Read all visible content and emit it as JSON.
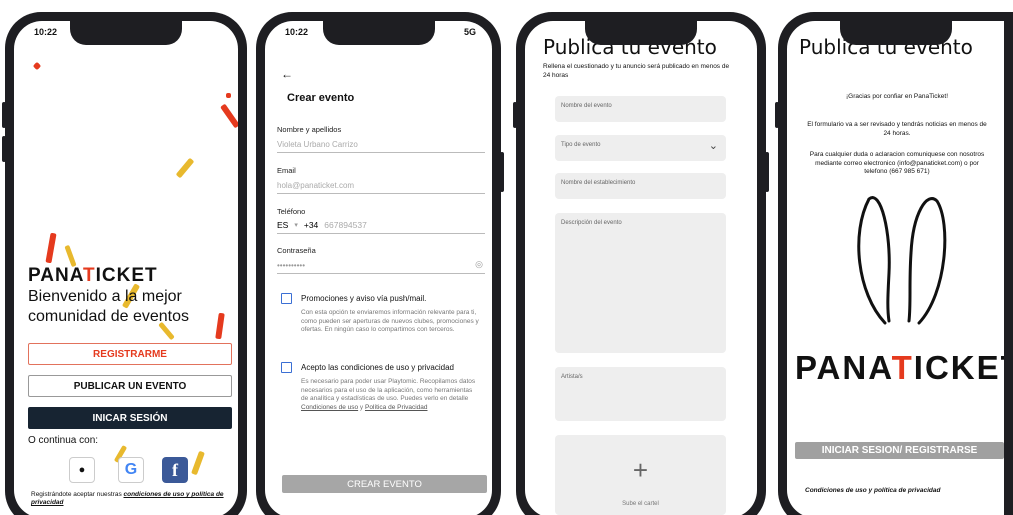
{
  "screen1": {
    "time": "10:22",
    "logo_pre": "PANA",
    "logo_t": "T",
    "logo_post": "ICKET",
    "welcome": "Bienvenido a la mejor comunidad de eventos",
    "register_label": "REGISTRARME",
    "publish_label": "PUBLICAR UN EVENTO",
    "login_label": "INICAR SESIÓN",
    "continue_label": "O continua con:",
    "terms_prefix": "Registrándote aceptar nuestras ",
    "terms_link": "condiciones de uso y política de privacidad",
    "social_icons": [
      "apple-icon",
      "google-icon",
      "facebook-icon"
    ],
    "accent_color": "#e53a1e",
    "dark_color": "#172432"
  },
  "screen2": {
    "time": "10:22",
    "network": "5G",
    "title": "Crear evento",
    "name_label": "Nombre y apellidos",
    "name_value": "Violeta Urbano Carrizo",
    "email_label": "Email",
    "email_value": "hola@panaticket.com",
    "phone_label": "Teléfono",
    "phone_country": "ES",
    "phone_prefix": "+34",
    "phone_value": "667894537",
    "password_label": "Contraseña",
    "password_value": "••••••••••",
    "promo_title": "Promociones y aviso vía push/mail.",
    "promo_desc": "Con esta opción te enviaremos información relevante para ti, como pueden ser aperturas de nuevos clubes, promociones y ofertas. En ningún caso lo compartimos con terceros.",
    "terms_title": "Acepto las condiciones de uso y privacidad",
    "terms_desc": "Es necesario para poder usar Playtomic. Recopilamos datos necesarios para el uso de la aplicación, como herramientas de analítica y estadísticas de uso. Puedes verlo en detalle",
    "terms_link1": "Condiciones de uso",
    "terms_and": " y ",
    "terms_link2": "Política de Privacidad",
    "submit_label": "CREAR EVENTO"
  },
  "screen3": {
    "title": "Publica tu evento",
    "subtitle": "Rellena el cuestionado y tu anuncio será publicado en menos de 24 horas",
    "field_name": "Nombre del evento",
    "field_type": "Tipo de evento",
    "field_venue": "Nombre del establecimiento",
    "field_desc": "Descripción del evento",
    "field_artists": "Artista/s",
    "upload_label": "Sube el cartel"
  },
  "screen4": {
    "title": "Publica tu evento",
    "thanks": "¡Gracias por confiar en PanaTicket!",
    "review": "El formulario va a ser revisado y tendrás noticias en menos de 24 horas.",
    "contact": "Para cualquier duda o aclaracion comuniquese con nosotros mediante correo electronico (info@panaticket.com) o por telefono (667 985 671)",
    "logo_pre": "PANA",
    "logo_t": "T",
    "logo_post": "ICKET",
    "button_label": "INICIAR SESION/ REGISTRARSE",
    "terms": "Condiciones de uso y política de privacidad"
  }
}
